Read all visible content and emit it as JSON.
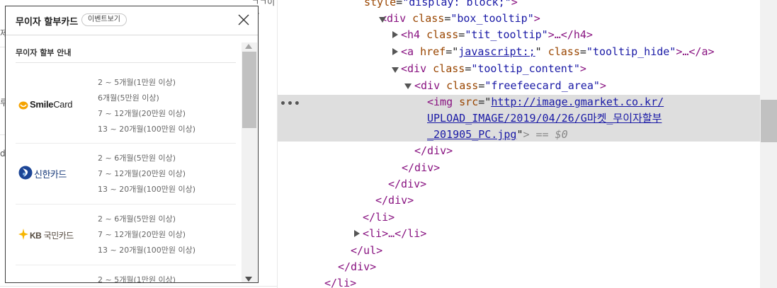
{
  "page": {
    "fragments": [
      "ㄱㄱ이차",
      "제",
      "루",
      "d"
    ]
  },
  "popup": {
    "title": "무이자 할부카드",
    "event_button": "이벤트보기",
    "section_title": "무이자 할부 안내",
    "cards": [
      {
        "name": "Smile Card",
        "logo_icon": "smilecard-logo",
        "logo_text": {
          "bold": "Smile",
          "normal": "Card"
        },
        "terms": [
          "2 ~ 5개월(1만원 이상)",
          "6개월(5만원 이상)",
          "7 ~ 12개월(20만원 이상)",
          "13 ~ 20개월(100만원 이상)"
        ]
      },
      {
        "name": "신한카드",
        "logo_icon": "shinhan-logo",
        "logo_text": "신한카드",
        "terms": [
          "2 ~ 6개월(5만원 이상)",
          "7 ~ 12개월(20만원 이상)",
          "13 ~ 20개월(100만원 이상)"
        ]
      },
      {
        "name": "KB국민카드",
        "logo_icon": "kb-logo",
        "logo_text": {
          "bold": "KB",
          "normal": " 국민카드"
        },
        "terms": [
          "2 ~ 6개월(5만원 이상)",
          "7 ~ 12개월(20만원 이상)",
          "13 ~ 20개월(100만원 이상)"
        ]
      },
      {
        "name": "",
        "logo_icon": "",
        "terms": [
          "2 ~ 5개월(1만원 이상)"
        ]
      }
    ]
  },
  "devtools": {
    "lines": {
      "l0_attr": "style",
      "l0_val": "\"display: block;\"",
      "l1_tag_open": "<div ",
      "l1_attr": "class",
      "l1_val": "\"box_tooltip\"",
      "l1_close": ">",
      "l2_tag": "<h4 ",
      "l2_attr": "class",
      "l2_val": "\"tit_tooltip\"",
      "l2_rest": ">…</h4>",
      "l3_tag": "<a ",
      "l3_attr1": "href",
      "l3_link": "javascript:;",
      "l3_attr2": "class",
      "l3_val2": "\"tooltip_hide\"",
      "l3_rest": ">…</a>",
      "l4_tag": "<div ",
      "l4_attr": "class",
      "l4_val": "\"tooltip_content\"",
      "l5_tag": "<div ",
      "l5_attr": "class",
      "l5_val": "\"freefeecard_area\"",
      "l6_tag": "<img ",
      "l6_attr": "src",
      "l6_link1": "http://image.gmarket.co.kr/",
      "l6_link2": "UPLOAD_IMAGE/2019/04/26/G마켓_무이자할부",
      "l6_link3": "_201905_PC.jpg",
      "l6_rest": "> == $0",
      "dots": "•••",
      "l7": "</div>",
      "l8": "</div>",
      "l9": "</div>",
      "l10": "</div>",
      "l11": "</li>",
      "l12_tag": "<li>",
      "l12_rest": "…</li>",
      "l13": "</ul>",
      "l14": "</div>",
      "l15": "</li>"
    }
  },
  "colors": {
    "tag": "#881280",
    "attr_name": "#994500",
    "attr_value": "#1a1aa6",
    "selection_bg": "#dedede"
  }
}
